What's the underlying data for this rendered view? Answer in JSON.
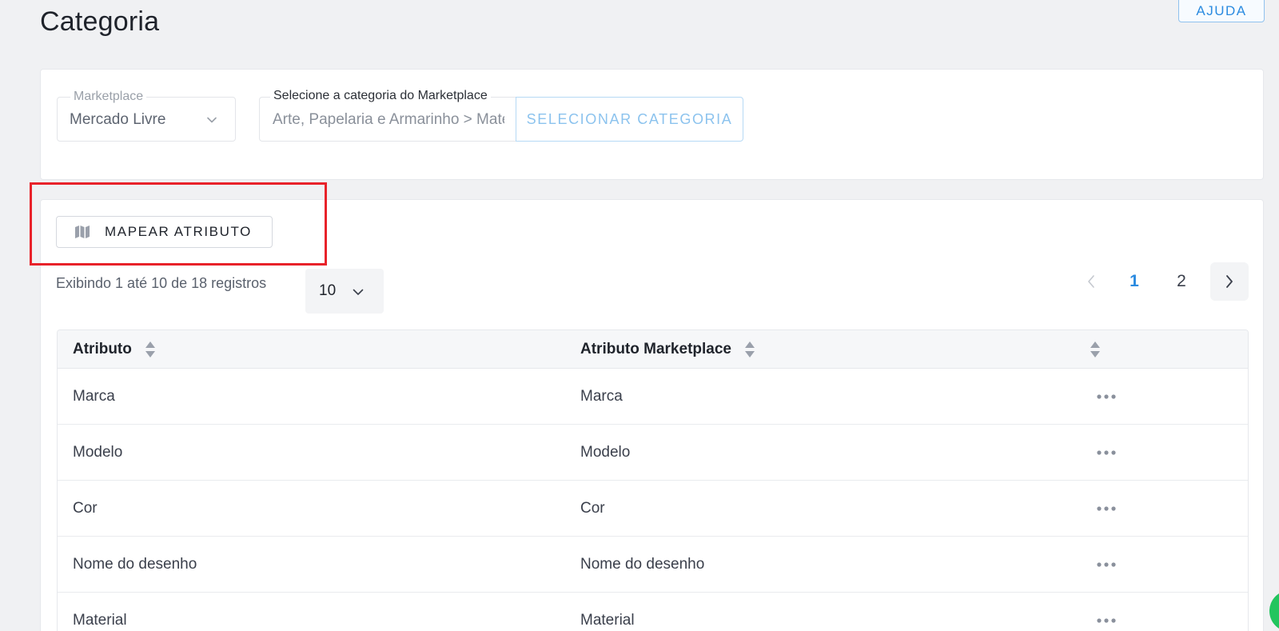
{
  "page": {
    "title": "Categoria",
    "help_label": "AJUDA"
  },
  "filters": {
    "marketplace_label": "Marketplace",
    "marketplace_value": "Mercado Livre",
    "category_label": "Selecione a categoria do Marketplace",
    "category_value": "Arte, Papelaria e Armarinho > Materiais Escolares",
    "select_category_label": "SELECIONAR CATEGORIA"
  },
  "toolbar": {
    "map_attribute_label": "MAPEAR ATRIBUTO"
  },
  "listing": {
    "showing_text": "Exibindo 1 até 10 de 18 registros",
    "page_size": "10",
    "pages": [
      "1",
      "2"
    ],
    "current_page": "1"
  },
  "table": {
    "columns": [
      "Atributo",
      "Atributo Marketplace",
      ""
    ],
    "rows": [
      {
        "attribute": "Marca",
        "marketplace_attribute": "Marca"
      },
      {
        "attribute": "Modelo",
        "marketplace_attribute": "Modelo"
      },
      {
        "attribute": "Cor",
        "marketplace_attribute": "Cor"
      },
      {
        "attribute": "Nome do desenho",
        "marketplace_attribute": "Nome do desenho"
      },
      {
        "attribute": "Material",
        "marketplace_attribute": "Material"
      }
    ]
  },
  "colors": {
    "accent": "#2b8be0",
    "highlight": "#e8222a",
    "chat_button": "#22c55e"
  },
  "icons": {
    "map": "map-icon",
    "chevron_down": "chevron-down-icon",
    "chevron_left": "chevron-left-icon",
    "chevron_right": "chevron-right-icon",
    "sort": "sort-icon",
    "more": "more-horizontal-icon"
  }
}
